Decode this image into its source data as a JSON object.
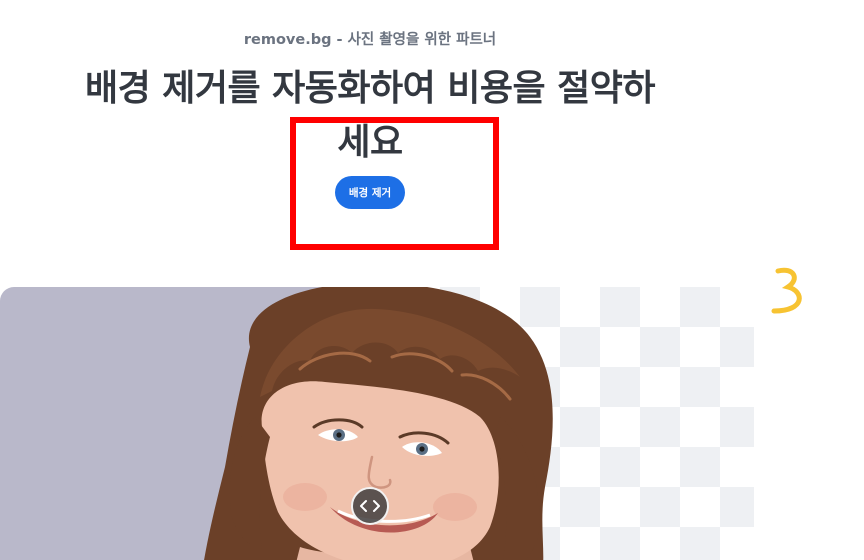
{
  "hero": {
    "eyebrow": "remove.bg - 사진 촬영을 위한 파트너",
    "headline_line1": "배경 제거를 자동화하여 비용을 절약하",
    "headline_line2": "세요",
    "cta_label": "배경 제거"
  },
  "comparison": {
    "slider_icon": "chevrons-left-right-icon",
    "checker_colors": [
      "#ffffff",
      "#eef0f3"
    ],
    "original_background": "#b9b8ca"
  },
  "colors": {
    "accent": "#1d6fe6",
    "highlight": "#ff0000",
    "squiggle": "#f7c332",
    "heading": "#333840",
    "eyebrow": "#6b7380"
  }
}
